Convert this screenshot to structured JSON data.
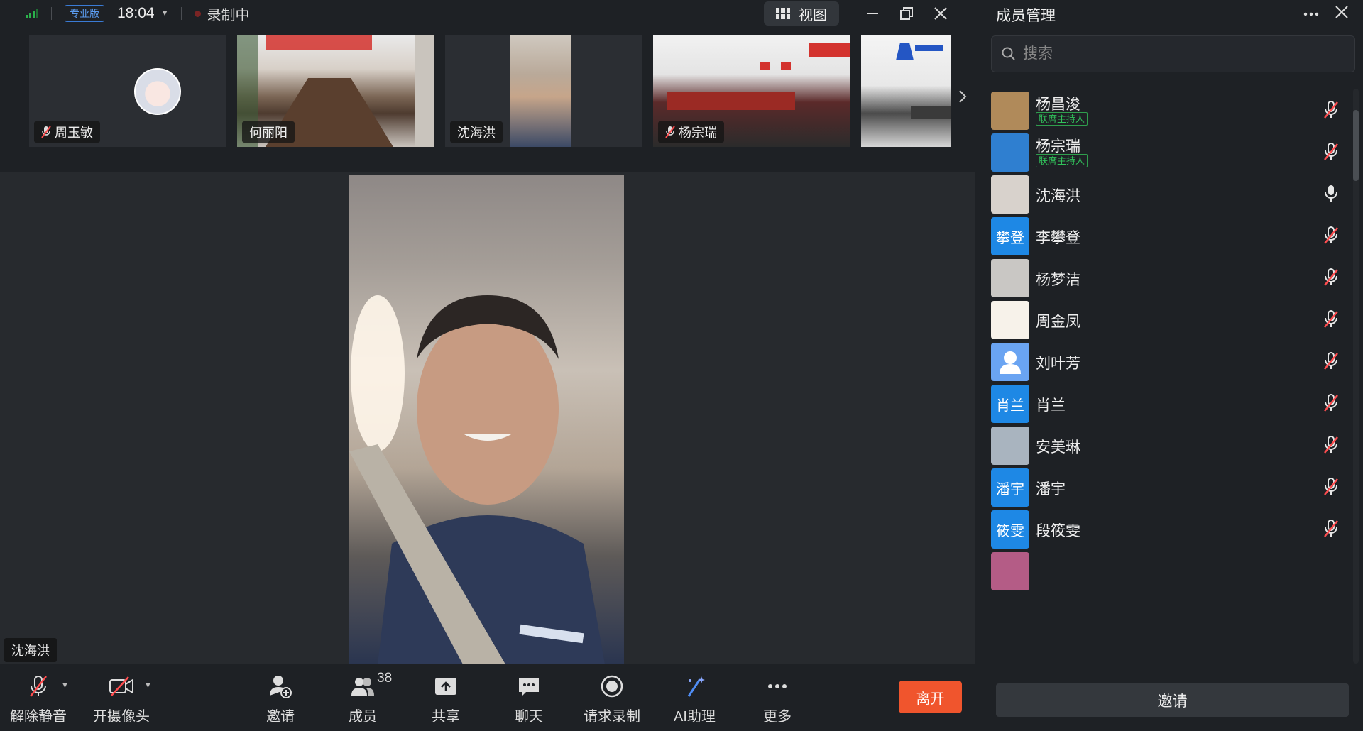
{
  "topbar": {
    "edition_badge": "专业版",
    "time": "18:04",
    "recording_status": "录制中",
    "view_button_label": "视图"
  },
  "thumbnails": [
    {
      "name": "周玉敏",
      "muted": true
    },
    {
      "name": "何丽阳",
      "muted": false
    },
    {
      "name": "沈海洪",
      "muted": false
    },
    {
      "name": "杨宗瑞",
      "muted": true
    },
    {
      "name": "",
      "muted": false
    }
  ],
  "stage": {
    "active_speaker": "沈海洪"
  },
  "toolbar": {
    "unmute_label": "解除静音",
    "camera_label": "开摄像头",
    "invite_label": "邀请",
    "members_label": "成员",
    "members_count": "38",
    "share_label": "共享",
    "chat_label": "聊天",
    "record_label": "请求录制",
    "ai_label": "AI助理",
    "more_label": "更多",
    "leave_label": "离开"
  },
  "panel": {
    "title": "成员管理",
    "search_placeholder": "搜索",
    "invite_button": "邀请",
    "members": [
      {
        "name": "杨昌浚",
        "badge": "联席主持人",
        "avatar": "photo",
        "avatar_color": "#b08a5a",
        "mic": "muted"
      },
      {
        "name": "杨宗瑞",
        "badge": "联席主持人",
        "avatar": "photo",
        "avatar_color": "#2f7fd0",
        "mic": "muted"
      },
      {
        "name": "沈海洪",
        "badge": "",
        "avatar": "photo",
        "avatar_color": "#d8d2cc",
        "mic": "on"
      },
      {
        "name": "李攀登",
        "badge": "",
        "avatar": "text",
        "avatar_text": "攀登",
        "avatar_color": "#1e88e5",
        "mic": "muted"
      },
      {
        "name": "杨梦洁",
        "badge": "",
        "avatar": "photo",
        "avatar_color": "#c9c7c4",
        "mic": "muted"
      },
      {
        "name": "周金凤",
        "badge": "",
        "avatar": "photo",
        "avatar_color": "#f7f2ea",
        "mic": "muted"
      },
      {
        "name": "刘叶芳",
        "badge": "",
        "avatar": "default",
        "avatar_color": "#6aa4f2",
        "mic": "muted"
      },
      {
        "name": "肖兰",
        "badge": "",
        "avatar": "text",
        "avatar_text": "肖兰",
        "avatar_color": "#1e88e5",
        "mic": "muted"
      },
      {
        "name": "安美琳",
        "badge": "",
        "avatar": "photo",
        "avatar_color": "#a9b4bf",
        "mic": "muted"
      },
      {
        "name": "潘宇",
        "badge": "",
        "avatar": "text",
        "avatar_text": "潘宇",
        "avatar_color": "#1e88e5",
        "mic": "muted"
      },
      {
        "name": "段筱雯",
        "badge": "",
        "avatar": "text",
        "avatar_text": "筱雯",
        "avatar_color": "#1e88e5",
        "mic": "muted"
      }
    ]
  },
  "colors": {
    "accent_blue": "#1e88e5",
    "leave_red": "#f0552d",
    "cohost_green": "#31c15a",
    "signal_green": "#2bb24c"
  }
}
